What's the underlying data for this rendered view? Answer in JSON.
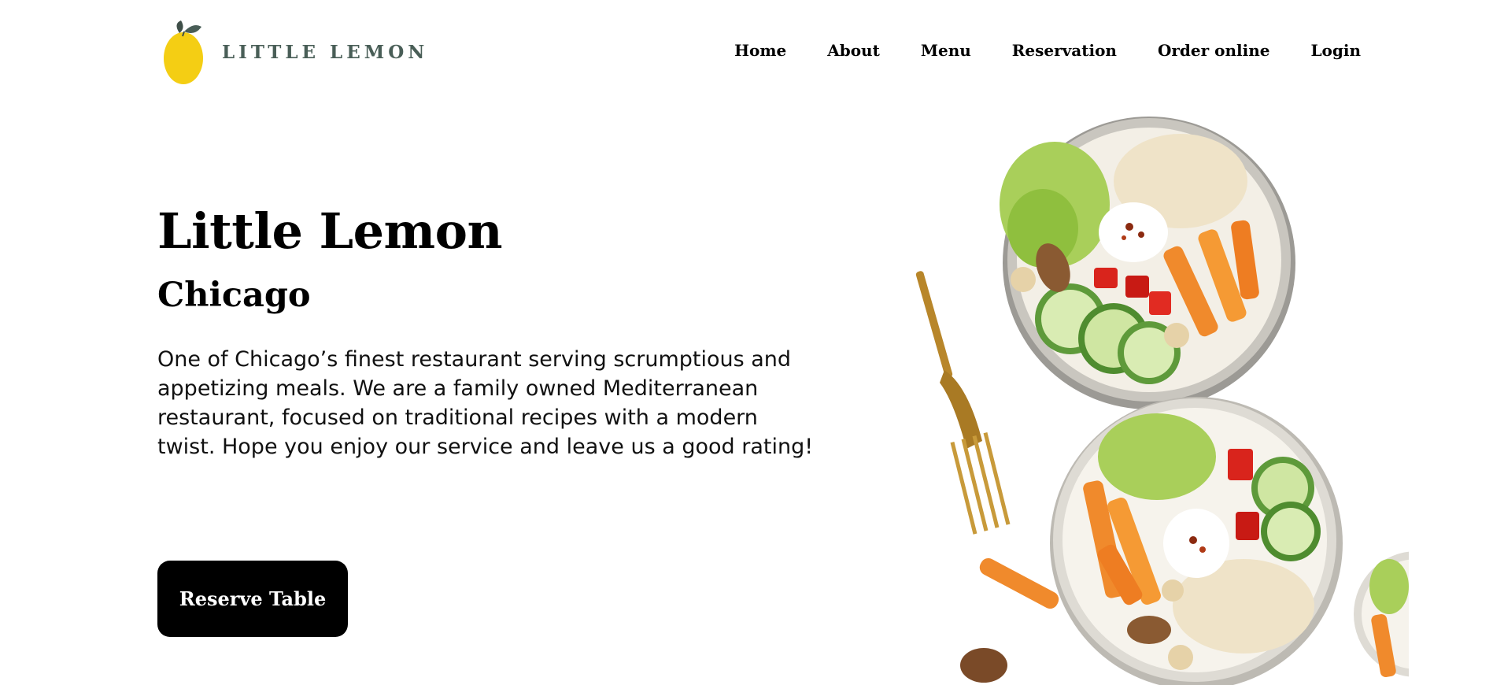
{
  "brand": {
    "logo_text": "LITTLE LEMON"
  },
  "nav": {
    "items": [
      "Home",
      "About",
      "Menu",
      "Reservation",
      "Order online",
      "Login"
    ]
  },
  "hero": {
    "title": "Little Lemon",
    "subtitle": "Chicago",
    "description": "One of Chicago’s finest restaurant serving scrumptious and appetizing meals. We are a family owned Mediterranean restaurant, focused on traditional recipes with a modern twist. Hope you enjoy our service and leave us a good rating!",
    "cta_label": "Reserve Table"
  },
  "colors": {
    "brand_green": "#495E57",
    "lemon_yellow": "#F4CE14",
    "button_bg": "#000000",
    "button_text": "#FFFFFF"
  },
  "icons": {
    "logo": "lemon-icon"
  }
}
